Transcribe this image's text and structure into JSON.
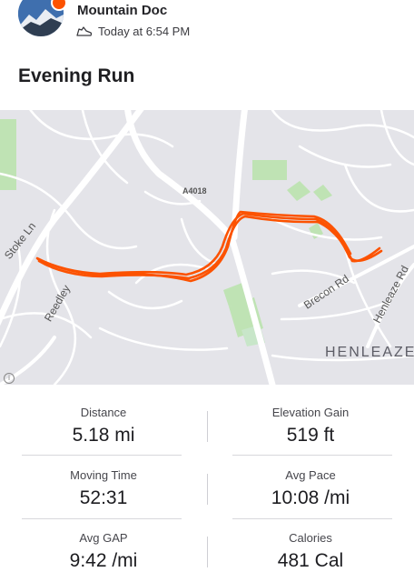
{
  "header": {
    "athlete_name": "Mountain Doc",
    "timestamp": "Today at 6:54 PM",
    "activity_icon": "running-shoe-icon"
  },
  "activity": {
    "title": "Evening Run"
  },
  "map": {
    "labels": {
      "stoke": "Stoke Ln",
      "reedley": "Reedley",
      "a4018": "A4018",
      "brecon": "Brecon Rd",
      "henleaze_rd": "Henleaze Rd",
      "henleaze": "HENLEAZE"
    },
    "route_color": "#fc5200"
  },
  "stats": [
    {
      "label": "Distance",
      "value": "5.18 mi"
    },
    {
      "label": "Elevation Gain",
      "value": "519 ft"
    },
    {
      "label": "Moving Time",
      "value": "52:31"
    },
    {
      "label": "Avg Pace",
      "value": "10:08 /mi"
    },
    {
      "label": "Avg GAP",
      "value": "9:42 /mi"
    },
    {
      "label": "Calories",
      "value": "481 Cal"
    }
  ]
}
